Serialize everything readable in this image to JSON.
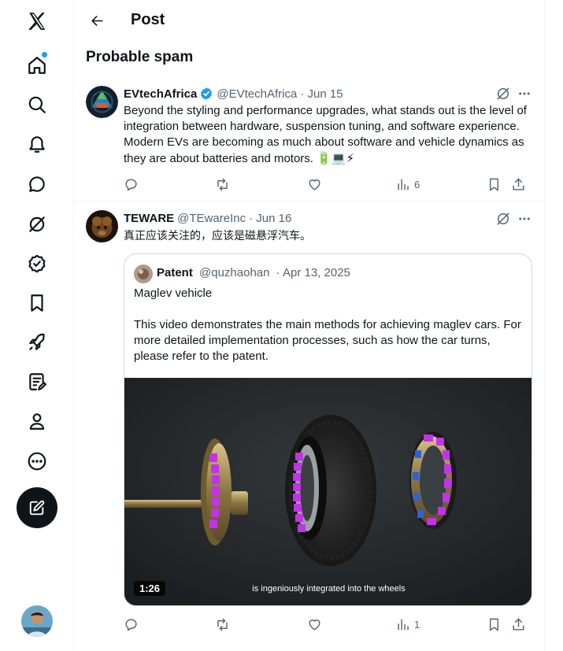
{
  "nav": {
    "items": [
      {
        "name": "x-logo-icon",
        "label": "X"
      },
      {
        "name": "home-icon",
        "label": "Home"
      },
      {
        "name": "search-icon",
        "label": "Explore"
      },
      {
        "name": "bell-icon",
        "label": "Notifications"
      },
      {
        "name": "message-icon",
        "label": "Messages"
      },
      {
        "name": "grok-icon",
        "label": "Grok"
      },
      {
        "name": "verified-org-icon",
        "label": "Verified Orgs"
      },
      {
        "name": "bookmark-icon",
        "label": "Bookmarks"
      },
      {
        "name": "rocket-icon",
        "label": "Jobs"
      },
      {
        "name": "article-icon",
        "label": "Articles"
      },
      {
        "name": "profile-icon",
        "label": "Profile"
      },
      {
        "name": "more-circle-icon",
        "label": "More"
      }
    ],
    "notification_dot_color": "#1d9bf0",
    "compose_icon": "compose-icon"
  },
  "header": {
    "title": "Post",
    "back_icon": "arrow-left-icon"
  },
  "section_title": "Probable spam",
  "posts": [
    {
      "name": "EVtechAfrica",
      "verified": true,
      "handle": "@EVtechAfrica",
      "date": "· Jun 15",
      "text": "Beyond the styling and performance upgrades, what stands out is the level of integration between hardware, suspension tuning, and software experience. Modern EVs are becoming as much about software and vehicle dynamics as they are about batteries and motors.",
      "emoji": "🔋💻⚡",
      "views": "6"
    },
    {
      "name": "TEWARE",
      "handle": "@TEwareInc",
      "date": "· Jun 16",
      "text": "真正应该关注的，应该是磁悬浮汽车。",
      "views": "1",
      "quote": {
        "name": "Patent",
        "handle": "@quzhaohan",
        "date": "· Apr 13, 2025",
        "paragraphs": [
          "Maglev vehicle",
          "This video demonstrates the main methods for achieving maglev cars. For more detailed implementation processes, such as how the car turns, please refer to the patent."
        ],
        "video": {
          "duration": "1:26",
          "caption": "is ingeniously integrated into the wheels"
        }
      }
    }
  ],
  "colors": {
    "accent": "#1d9bf0",
    "text": "#0f1419",
    "muted": "#536471",
    "border": "#eff3f4",
    "magnet": "#c233e8"
  }
}
